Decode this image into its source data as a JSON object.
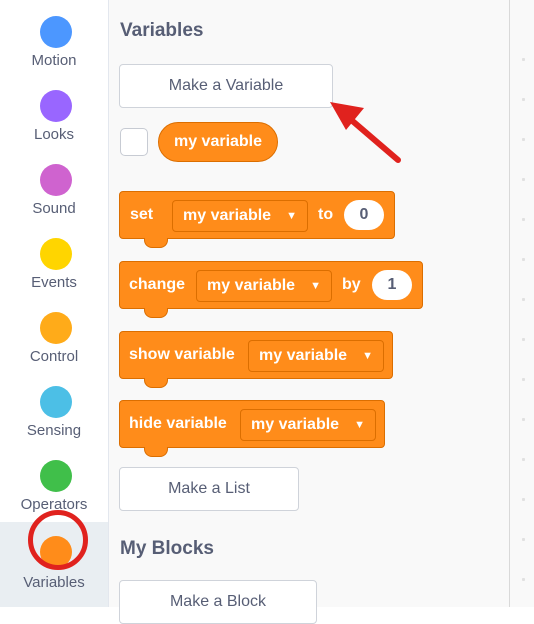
{
  "categories": [
    {
      "label": "Motion",
      "color": "#4c97ff",
      "icon": "motion-dot-icon"
    },
    {
      "label": "Looks",
      "color": "#9966ff",
      "icon": "looks-dot-icon"
    },
    {
      "label": "Sound",
      "color": "#cf63cf",
      "icon": "sound-dot-icon"
    },
    {
      "label": "Events",
      "color": "#ffd500",
      "icon": "events-dot-icon"
    },
    {
      "label": "Control",
      "color": "#ffab19",
      "icon": "control-dot-icon"
    },
    {
      "label": "Sensing",
      "color": "#4cbfe6",
      "icon": "sensing-dot-icon"
    },
    {
      "label": "Operators",
      "color": "#40bf4a",
      "icon": "operators-dot-icon"
    },
    {
      "label": "Variables",
      "color": "#ff8c1a",
      "icon": "variables-dot-icon",
      "selected": true
    }
  ],
  "palette": {
    "variables_title": "Variables",
    "make_variable_label": "Make a Variable",
    "variable_reporter": "my variable",
    "blocks": {
      "set": {
        "label": "set",
        "dropdown": "my variable",
        "to_label": "to",
        "value": "0"
      },
      "change": {
        "label": "change",
        "dropdown": "my variable",
        "by_label": "by",
        "value": "1"
      },
      "show": {
        "label": "show variable",
        "dropdown": "my variable"
      },
      "hide": {
        "label": "hide variable",
        "dropdown": "my variable"
      }
    },
    "make_list_label": "Make a List",
    "my_blocks_title": "My Blocks",
    "make_block_label": "Make a Block"
  },
  "annotations": {
    "arrow_color": "#e0221e",
    "circle_color": "#e0221e"
  }
}
